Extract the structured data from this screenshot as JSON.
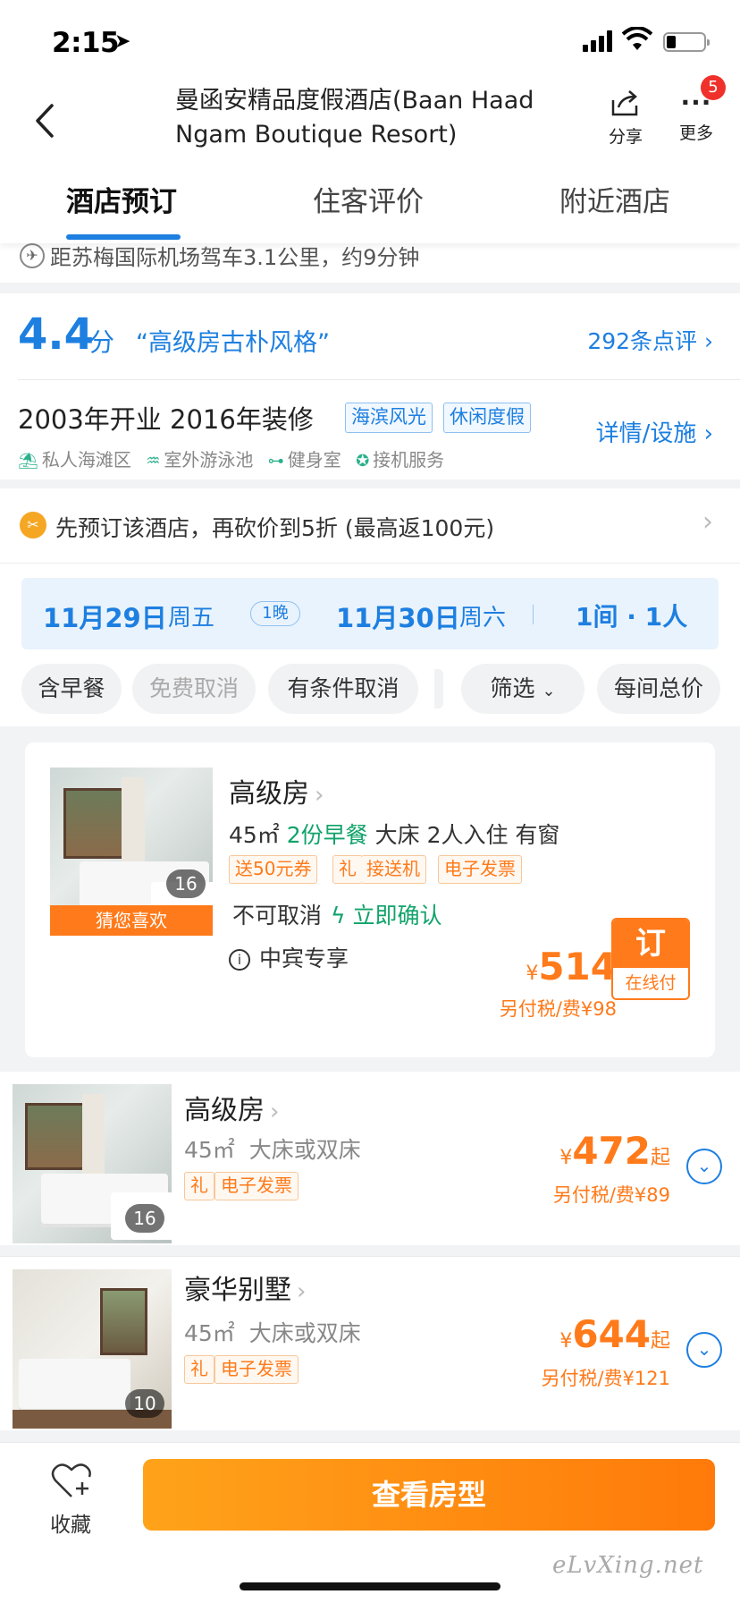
{
  "status": {
    "time": "2:15"
  },
  "nav": {
    "title": "曼函安精品度假酒店(Baan Haad Ngam Boutique Resort)",
    "share_label": "分享",
    "more_label": "更多",
    "more_badge": "5"
  },
  "tabs": [
    {
      "label": "酒店预订",
      "active": true
    },
    {
      "label": "住客评价",
      "active": false
    },
    {
      "label": "附近酒店",
      "active": false
    }
  ],
  "airport_text": "距苏梅国际机场驾车3.1公里，约9分钟",
  "rating": {
    "score": "4.4",
    "unit": "分",
    "quote": "“高级房古朴风格”",
    "reviews_link": "292条点评"
  },
  "hotel_info": {
    "opened": "2003年开业 2016年装修",
    "tags": [
      "海滨风光",
      "休闲度假"
    ],
    "details_link": "详情/设施",
    "facilities": [
      "私人海滩区",
      "室外游泳池",
      "健身室",
      "接机服务"
    ]
  },
  "promo": {
    "text": "先预订该酒店，再砍价到5折 (最高返100元)"
  },
  "dates": {
    "checkin": "11月29日",
    "checkin_week": "周五",
    "nights": "1晚",
    "checkout": "11月30日",
    "checkout_week": "周六",
    "guests": "1间 · 1人"
  },
  "filters": [
    "含早餐",
    "免费取消",
    "有条件取消",
    "筛选",
    "每间总价"
  ],
  "featured": {
    "name": "高级房",
    "meta_size": "45㎡",
    "meta_breakfast": "2份早餐",
    "meta_rest": "大床 2人入住 有窗",
    "tags": [
      "送50元券",
      "礼",
      "接送机",
      "电子发票"
    ],
    "cancel": "不可取消",
    "confirm": "立即确认",
    "vip": "中宾专享",
    "photo_count": "16",
    "photo_label": "猜您喜欢",
    "currency": "¥",
    "price": "514",
    "tax": "另付税/费¥98",
    "book_label": "订",
    "book_sub": "在线付"
  },
  "rooms": [
    {
      "name": "高级房",
      "size": "45㎡",
      "bed": "大床或双床",
      "tags": [
        "礼",
        "电子发票"
      ],
      "photo_count": "16",
      "currency": "¥",
      "price": "472",
      "price_suffix": "起",
      "tax": "另付税/费¥89"
    },
    {
      "name": "豪华别墅",
      "size": "45㎡",
      "bed": "大床或双床",
      "tags": [
        "礼",
        "电子发票"
      ],
      "photo_count": "10",
      "currency": "¥",
      "price": "644",
      "price_suffix": "起",
      "tax": "另付税/费¥121"
    }
  ],
  "bottom": {
    "favorite_label": "收藏",
    "view_button": "查看房型",
    "watermark": "eLvXing.net"
  },
  "colors": {
    "accent_blue": "#1d7fe0",
    "accent_orange": "#ff7a1a",
    "green": "#10a36a"
  }
}
